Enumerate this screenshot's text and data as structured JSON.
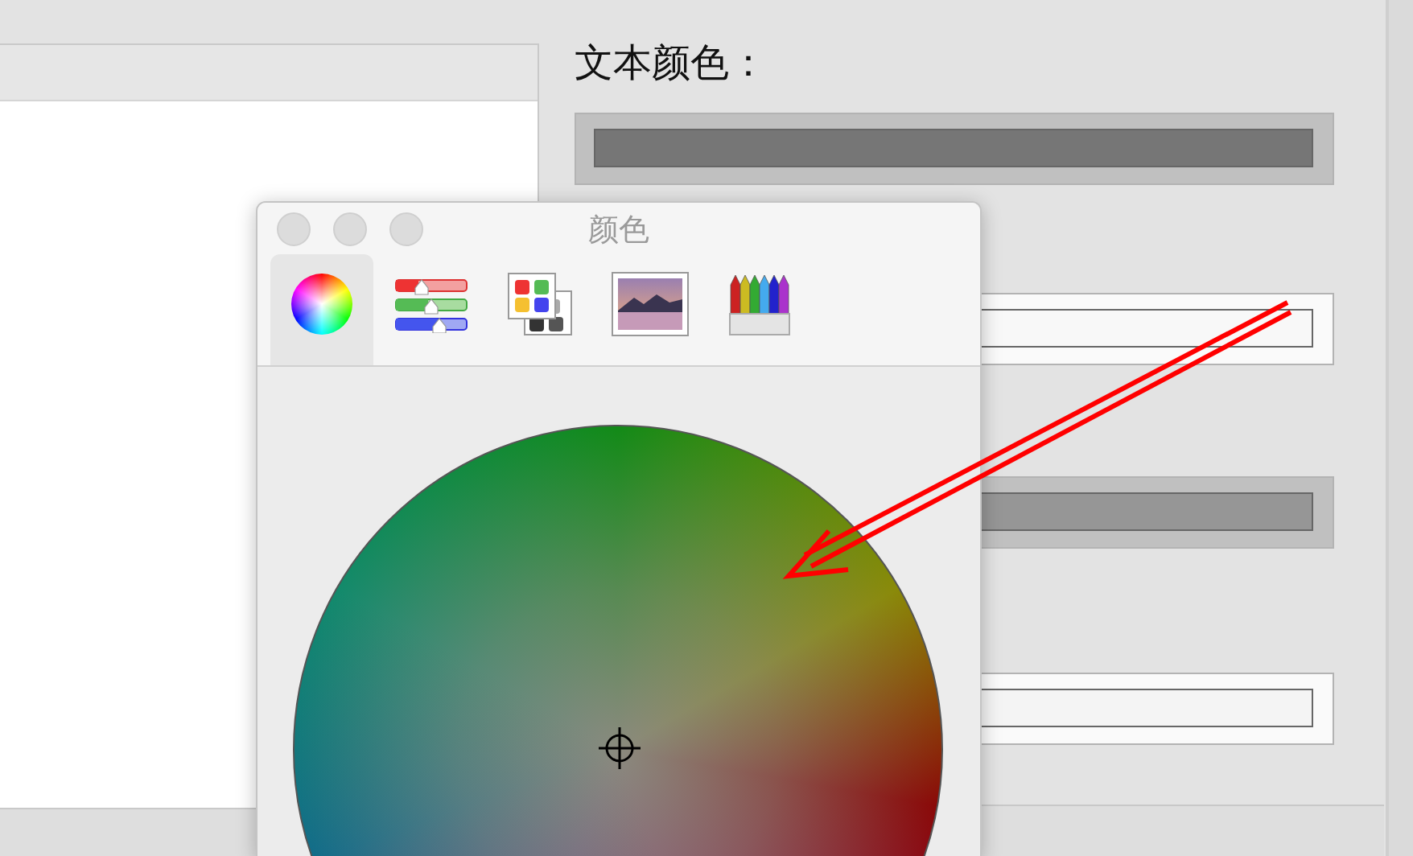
{
  "settings": {
    "label": "文本颜色：",
    "color_wells": [
      {
        "color": "#767676"
      },
      {
        "color": "#f8f8f8"
      },
      {
        "color": "#969696"
      },
      {
        "color": "#f4f4f4"
      }
    ]
  },
  "color_panel": {
    "title": "颜色",
    "tabs": [
      {
        "kind": "wheel",
        "selected": true
      },
      {
        "kind": "sliders",
        "selected": false
      },
      {
        "kind": "palettes",
        "selected": false
      },
      {
        "kind": "image",
        "selected": false
      },
      {
        "kind": "pencils",
        "selected": false
      }
    ]
  }
}
